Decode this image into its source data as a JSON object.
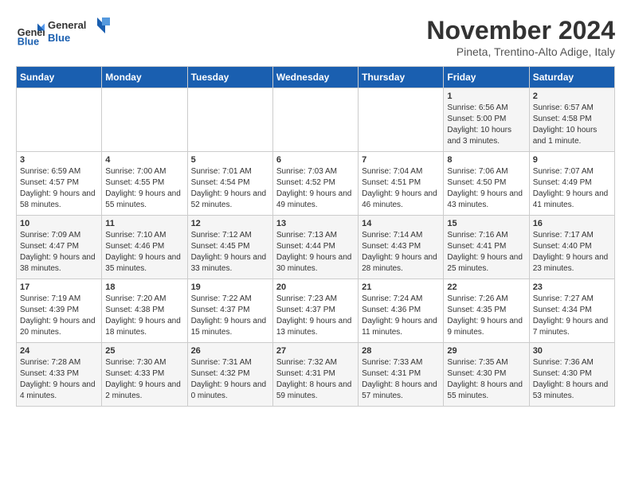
{
  "logo": {
    "line1": "General",
    "line2": "Blue"
  },
  "title": "November 2024",
  "subtitle": "Pineta, Trentino-Alto Adige, Italy",
  "days_header": [
    "Sunday",
    "Monday",
    "Tuesday",
    "Wednesday",
    "Thursday",
    "Friday",
    "Saturday"
  ],
  "weeks": [
    [
      {
        "day": "",
        "info": ""
      },
      {
        "day": "",
        "info": ""
      },
      {
        "day": "",
        "info": ""
      },
      {
        "day": "",
        "info": ""
      },
      {
        "day": "",
        "info": ""
      },
      {
        "day": "1",
        "info": "Sunrise: 6:56 AM\nSunset: 5:00 PM\nDaylight: 10 hours and 3 minutes."
      },
      {
        "day": "2",
        "info": "Sunrise: 6:57 AM\nSunset: 4:58 PM\nDaylight: 10 hours and 1 minute."
      }
    ],
    [
      {
        "day": "3",
        "info": "Sunrise: 6:59 AM\nSunset: 4:57 PM\nDaylight: 9 hours and 58 minutes."
      },
      {
        "day": "4",
        "info": "Sunrise: 7:00 AM\nSunset: 4:55 PM\nDaylight: 9 hours and 55 minutes."
      },
      {
        "day": "5",
        "info": "Sunrise: 7:01 AM\nSunset: 4:54 PM\nDaylight: 9 hours and 52 minutes."
      },
      {
        "day": "6",
        "info": "Sunrise: 7:03 AM\nSunset: 4:52 PM\nDaylight: 9 hours and 49 minutes."
      },
      {
        "day": "7",
        "info": "Sunrise: 7:04 AM\nSunset: 4:51 PM\nDaylight: 9 hours and 46 minutes."
      },
      {
        "day": "8",
        "info": "Sunrise: 7:06 AM\nSunset: 4:50 PM\nDaylight: 9 hours and 43 minutes."
      },
      {
        "day": "9",
        "info": "Sunrise: 7:07 AM\nSunset: 4:49 PM\nDaylight: 9 hours and 41 minutes."
      }
    ],
    [
      {
        "day": "10",
        "info": "Sunrise: 7:09 AM\nSunset: 4:47 PM\nDaylight: 9 hours and 38 minutes."
      },
      {
        "day": "11",
        "info": "Sunrise: 7:10 AM\nSunset: 4:46 PM\nDaylight: 9 hours and 35 minutes."
      },
      {
        "day": "12",
        "info": "Sunrise: 7:12 AM\nSunset: 4:45 PM\nDaylight: 9 hours and 33 minutes."
      },
      {
        "day": "13",
        "info": "Sunrise: 7:13 AM\nSunset: 4:44 PM\nDaylight: 9 hours and 30 minutes."
      },
      {
        "day": "14",
        "info": "Sunrise: 7:14 AM\nSunset: 4:43 PM\nDaylight: 9 hours and 28 minutes."
      },
      {
        "day": "15",
        "info": "Sunrise: 7:16 AM\nSunset: 4:41 PM\nDaylight: 9 hours and 25 minutes."
      },
      {
        "day": "16",
        "info": "Sunrise: 7:17 AM\nSunset: 4:40 PM\nDaylight: 9 hours and 23 minutes."
      }
    ],
    [
      {
        "day": "17",
        "info": "Sunrise: 7:19 AM\nSunset: 4:39 PM\nDaylight: 9 hours and 20 minutes."
      },
      {
        "day": "18",
        "info": "Sunrise: 7:20 AM\nSunset: 4:38 PM\nDaylight: 9 hours and 18 minutes."
      },
      {
        "day": "19",
        "info": "Sunrise: 7:22 AM\nSunset: 4:37 PM\nDaylight: 9 hours and 15 minutes."
      },
      {
        "day": "20",
        "info": "Sunrise: 7:23 AM\nSunset: 4:37 PM\nDaylight: 9 hours and 13 minutes."
      },
      {
        "day": "21",
        "info": "Sunrise: 7:24 AM\nSunset: 4:36 PM\nDaylight: 9 hours and 11 minutes."
      },
      {
        "day": "22",
        "info": "Sunrise: 7:26 AM\nSunset: 4:35 PM\nDaylight: 9 hours and 9 minutes."
      },
      {
        "day": "23",
        "info": "Sunrise: 7:27 AM\nSunset: 4:34 PM\nDaylight: 9 hours and 7 minutes."
      }
    ],
    [
      {
        "day": "24",
        "info": "Sunrise: 7:28 AM\nSunset: 4:33 PM\nDaylight: 9 hours and 4 minutes."
      },
      {
        "day": "25",
        "info": "Sunrise: 7:30 AM\nSunset: 4:33 PM\nDaylight: 9 hours and 2 minutes."
      },
      {
        "day": "26",
        "info": "Sunrise: 7:31 AM\nSunset: 4:32 PM\nDaylight: 9 hours and 0 minutes."
      },
      {
        "day": "27",
        "info": "Sunrise: 7:32 AM\nSunset: 4:31 PM\nDaylight: 8 hours and 59 minutes."
      },
      {
        "day": "28",
        "info": "Sunrise: 7:33 AM\nSunset: 4:31 PM\nDaylight: 8 hours and 57 minutes."
      },
      {
        "day": "29",
        "info": "Sunrise: 7:35 AM\nSunset: 4:30 PM\nDaylight: 8 hours and 55 minutes."
      },
      {
        "day": "30",
        "info": "Sunrise: 7:36 AM\nSunset: 4:30 PM\nDaylight: 8 hours and 53 minutes."
      }
    ]
  ]
}
